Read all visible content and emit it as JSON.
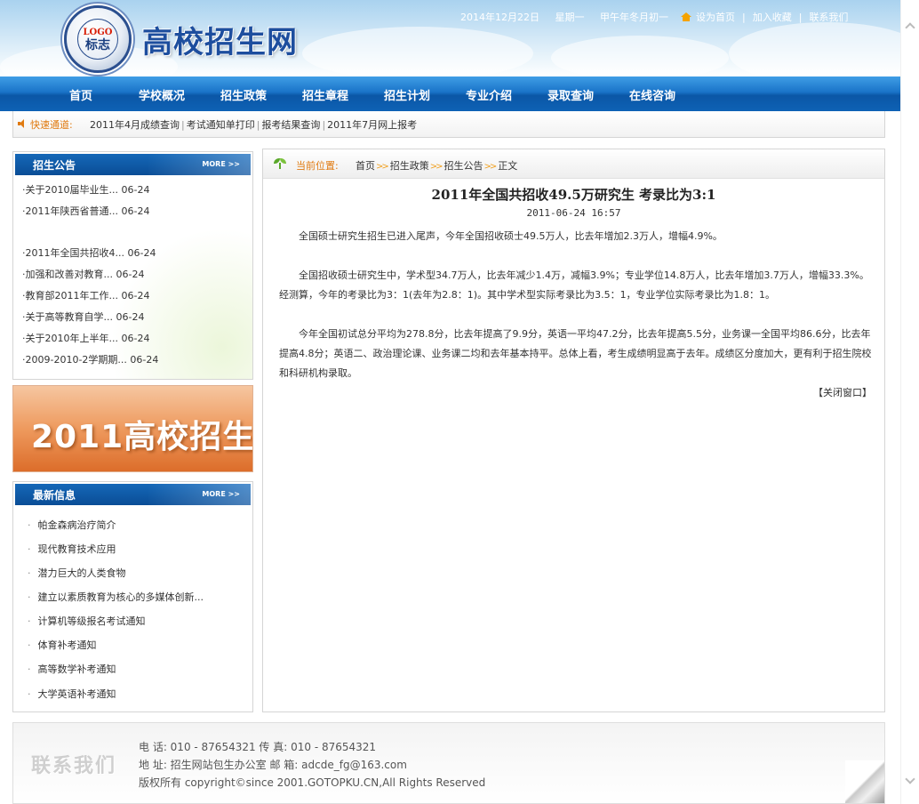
{
  "header": {
    "logo_line1": "LOGO",
    "logo_line2": "标志",
    "site_title": "高校招生网",
    "date": "2014年12月22日",
    "weekday": "星期一",
    "lunar": "甲午年冬月初一",
    "set_home": "设为首页",
    "add_fav": "加入收藏",
    "contact": "联系我们"
  },
  "nav": [
    "首页",
    "学校概况",
    "招生政策",
    "招生章程",
    "招生计划",
    "专业介绍",
    "录取查询",
    "在线咨询"
  ],
  "quick": {
    "label": "快速通道:",
    "links": [
      "2011年4月成绩查询",
      "考试通知单打印",
      "报考结果查询",
      "2011年7月网上报考"
    ]
  },
  "notice": {
    "title": "招生公告",
    "more": "MORE >>",
    "items": [
      {
        "text": "·关于2010届毕业生...",
        "date": "06-24"
      },
      {
        "text": "·2011年陕西省普通...",
        "date": "06-24"
      },
      {
        "text": "·2011年全国共招收4...",
        "date": "06-24"
      },
      {
        "text": "·加强和改善对教育...",
        "date": "06-24"
      },
      {
        "text": "·教育部2011年工作...",
        "date": "06-24"
      },
      {
        "text": "·关于高等教育自学...",
        "date": "06-24"
      },
      {
        "text": "·关于2010年上半年...",
        "date": "06-24"
      },
      {
        "text": "·2009-2010-2学期期...",
        "date": "06-24"
      }
    ]
  },
  "banner": {
    "text": "2011高校招生"
  },
  "news": {
    "title": "最新信息",
    "more": "MORE >>",
    "items": [
      "帕金森病治疗简介",
      "现代教育技术应用",
      "潜力巨大的人类食物",
      "建立以素质教育为核心的多媒体创新...",
      "计算机等级报名考试通知",
      "体育补考通知",
      "高等数学补考通知",
      "大学英语补考通知"
    ]
  },
  "breadcrumb": {
    "label": "当前位置:",
    "items": [
      "首页",
      "招生政策",
      "招生公告",
      "正文"
    ],
    "sep": ">>"
  },
  "article": {
    "title": "2011年全国共招收49.5万研究生 考录比为3:1",
    "date": "2011-06-24 16:57",
    "paragraphs": [
      "全国硕士研究生招生已进入尾声，今年全国招收硕士49.5万人，比去年增加2.3万人，增幅4.9%。",
      "全国招收硕士研究生中，学术型34.7万人，比去年减少1.4万，减幅3.9%；专业学位14.8万人，比去年增加3.7万人，增幅33.3%。经测算，今年的考录比为3：1(去年为2.8：1)。其中学术型实际考录比为3.5：1，专业学位实际考录比为1.8：1。",
      "今年全国初试总分平均为278.8分，比去年提高了9.9分，英语一平均47.2分，比去年提高5.5分，业务课一全国平均86.6分，比去年提高4.8分；英语二、政治理论课、业务课二均和去年基本持平。总体上看，考生成绩明显高于去年。成绩区分度加大，更有利于招生院校和科研机构录取。"
    ],
    "close": "【关闭窗口】"
  },
  "footer": {
    "brand": "联系我们",
    "line1": "电 话: 010 - 87654321 传 真: 010 - 87654321",
    "line2": "地 址: 招生网站包生办公室 邮 箱: adcde_fg@163.com",
    "line3": "版权所有 copyright©since 2001.GOTOPKU.CN,All Rights Reserved"
  },
  "icons": {
    "home": "home-icon",
    "speaker": "speaker-icon",
    "sprout": "sprout-icon"
  }
}
